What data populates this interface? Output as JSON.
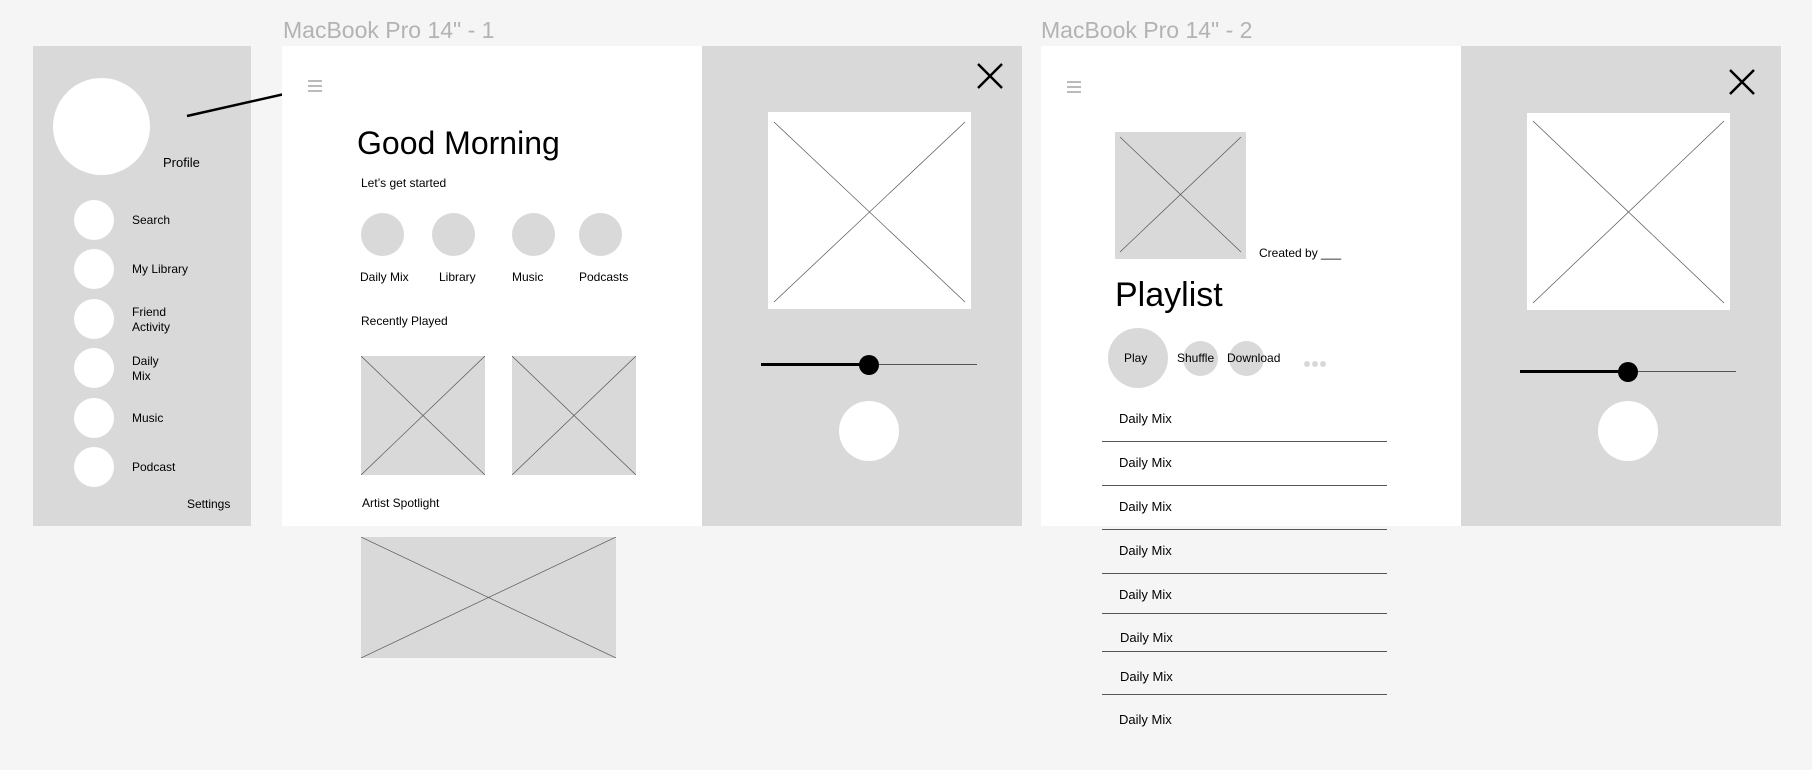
{
  "frames": {
    "frame1_title": "MacBook Pro 14\" - 1",
    "frame2_title": "MacBook Pro 14\" - 2"
  },
  "sidebar": {
    "profile_label": "Profile",
    "items": [
      {
        "label": "Search"
      },
      {
        "label": "My Library"
      },
      {
        "label": "Friend\nActivity"
      },
      {
        "label": "Daily\nMix"
      },
      {
        "label": "Music"
      },
      {
        "label": "Podcast"
      }
    ],
    "settings_label": "Settings"
  },
  "home": {
    "greeting": "Good Morning",
    "subtitle": "Let’s get started",
    "categories": [
      {
        "label": "Daily Mix"
      },
      {
        "label": "Library"
      },
      {
        "label": "Music"
      },
      {
        "label": "Podcasts"
      }
    ],
    "recently_played": "Recently Played",
    "artist_spotlight": "Artist Spotlight"
  },
  "player": {
    "progress": 0.5
  },
  "playlist": {
    "created_by": "Created by ___",
    "title": "Playlist",
    "play_label": "Play",
    "shuffle_label": "Shuffle",
    "download_label": "Download",
    "tracks": [
      "Daily Mix",
      "Daily Mix",
      "Daily Mix",
      "Daily Mix",
      "Daily Mix",
      "Daily Mix",
      "Daily Mix",
      "Daily Mix"
    ]
  },
  "player2": {
    "progress": 0.5
  },
  "icons": [
    "hamburger-icon",
    "close-icon",
    "more-dots-icon",
    "image-placeholder-icon"
  ],
  "colors": {
    "panel_gray": "#d9d9d9",
    "background": "#f5f5f5",
    "frame_title": "#b3b3b3"
  }
}
